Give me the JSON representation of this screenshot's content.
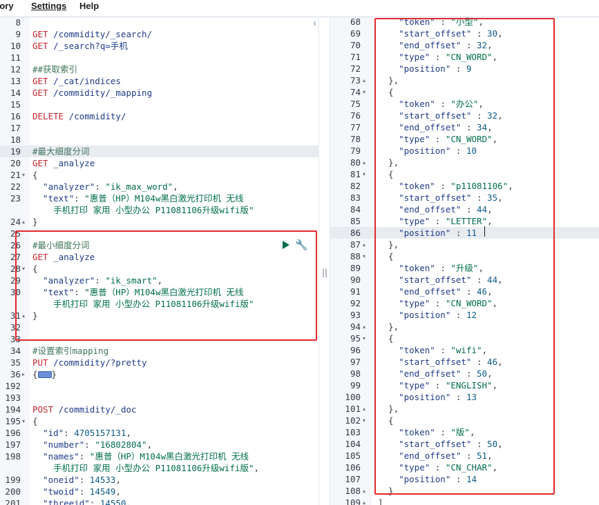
{
  "menu": {
    "items": [
      "tory",
      "Settings",
      "Help"
    ],
    "active_index": 1
  },
  "left_editor": {
    "lines": [
      {
        "n": "8",
        "parts": []
      },
      {
        "n": "9",
        "parts": [
          [
            "method",
            "GET"
          ],
          [
            "url",
            " /commidity/_search/"
          ]
        ]
      },
      {
        "n": "10",
        "parts": [
          [
            "method",
            "GET"
          ],
          [
            "url",
            " /_search?q=手机"
          ]
        ]
      },
      {
        "n": "11",
        "parts": []
      },
      {
        "n": "12",
        "parts": [
          [
            "comment",
            "##获取索引"
          ]
        ]
      },
      {
        "n": "13",
        "parts": [
          [
            "method",
            "GET"
          ],
          [
            "url",
            " /_cat/indices"
          ]
        ]
      },
      {
        "n": "14",
        "parts": [
          [
            "method",
            "GET"
          ],
          [
            "url",
            " /commidity/_mapping"
          ]
        ]
      },
      {
        "n": "15",
        "parts": []
      },
      {
        "n": "16",
        "parts": [
          [
            "method",
            "DELETE"
          ],
          [
            "url",
            " /commidity/"
          ]
        ]
      },
      {
        "n": "17",
        "parts": []
      },
      {
        "n": "18",
        "parts": []
      },
      {
        "n": "19",
        "hl": true,
        "parts": [
          [
            "comment",
            "#最大细度分词"
          ]
        ]
      },
      {
        "n": "20",
        "parts": [
          [
            "method",
            "GET"
          ],
          [
            "url",
            " _analyze"
          ]
        ]
      },
      {
        "n": "21",
        "fold": "▾",
        "parts": [
          [
            "punc",
            "{"
          ]
        ]
      },
      {
        "n": "22",
        "parts": [
          [
            "key",
            "  \"analyzer\""
          ],
          [
            "punc",
            ": "
          ],
          [
            "str",
            "\"ik_max_word\""
          ],
          [
            "punc",
            ","
          ]
        ]
      },
      {
        "n": "23",
        "parts": [
          [
            "key",
            "  \"text\""
          ],
          [
            "punc",
            ": "
          ],
          [
            "str",
            "\"惠普（HP）M104w黑白激光打印机 无线"
          ]
        ]
      },
      {
        "n": "",
        "parts": [
          [
            "str",
            "    手机打印 家用 小型办公 P11081106升级wifi版\""
          ]
        ]
      },
      {
        "n": "24",
        "fold": "▴",
        "parts": [
          [
            "punc",
            "}"
          ]
        ]
      },
      {
        "n": "25",
        "parts": []
      },
      {
        "n": "26",
        "parts": [
          [
            "comment",
            "#最小细度分词"
          ]
        ]
      },
      {
        "n": "27",
        "parts": [
          [
            "method",
            "GET"
          ],
          [
            "url",
            " _analyze"
          ]
        ]
      },
      {
        "n": "28",
        "fold": "▾",
        "parts": [
          [
            "punc",
            "{"
          ]
        ]
      },
      {
        "n": "29",
        "parts": [
          [
            "key",
            "  \"analyzer\""
          ],
          [
            "punc",
            ": "
          ],
          [
            "str",
            "\"ik_smart\""
          ],
          [
            "punc",
            ","
          ]
        ]
      },
      {
        "n": "30",
        "parts": [
          [
            "key",
            "  \"text\""
          ],
          [
            "punc",
            ": "
          ],
          [
            "str",
            "\"惠普（HP）M104w黑白激光打印机 无线"
          ]
        ]
      },
      {
        "n": "",
        "parts": [
          [
            "str",
            "    手机打印 家用 小型办公 P11081106升级wifi版\""
          ]
        ]
      },
      {
        "n": "31",
        "fold": "▴",
        "parts": [
          [
            "punc",
            "}"
          ]
        ]
      },
      {
        "n": "32",
        "parts": []
      },
      {
        "n": "33",
        "parts": []
      },
      {
        "n": "34",
        "parts": [
          [
            "comment",
            "#设置索引mapping"
          ]
        ]
      },
      {
        "n": "35",
        "parts": [
          [
            "method",
            "PUT"
          ],
          [
            "url",
            " /commidity/?pretty"
          ]
        ]
      },
      {
        "n": "36",
        "fold": "▸",
        "parts": [
          [
            "punc",
            "{"
          ],
          [
            "foldbox",
            ""
          ],
          [
            "punc",
            "}"
          ]
        ]
      },
      {
        "n": "192",
        "parts": []
      },
      {
        "n": "193",
        "parts": []
      },
      {
        "n": "194",
        "parts": [
          [
            "method",
            "POST"
          ],
          [
            "url",
            " /commidity/_doc"
          ]
        ]
      },
      {
        "n": "195",
        "fold": "▾",
        "parts": [
          [
            "punc",
            "{"
          ]
        ]
      },
      {
        "n": "196",
        "parts": [
          [
            "key",
            "  \"id\""
          ],
          [
            "punc",
            ": "
          ],
          [
            "num",
            "4705157131"
          ],
          [
            "punc",
            ","
          ]
        ]
      },
      {
        "n": "197",
        "parts": [
          [
            "key",
            "  \"number\""
          ],
          [
            "punc",
            ": "
          ],
          [
            "str",
            "\"16802804\""
          ],
          [
            "punc",
            ","
          ]
        ]
      },
      {
        "n": "198",
        "parts": [
          [
            "key",
            "  \"names\""
          ],
          [
            "punc",
            ": "
          ],
          [
            "str",
            "\"惠普（HP）M104w黑白激光打印机 无线"
          ]
        ]
      },
      {
        "n": "",
        "parts": [
          [
            "str",
            "    手机打印 家用 小型办公 P11081106升级wifi版\""
          ],
          [
            "punc",
            ","
          ]
        ]
      },
      {
        "n": "199",
        "parts": [
          [
            "key",
            "  \"oneid\""
          ],
          [
            "punc",
            ": "
          ],
          [
            "num",
            "14533"
          ],
          [
            "punc",
            ","
          ]
        ]
      },
      {
        "n": "200",
        "parts": [
          [
            "key",
            "  \"twoid\""
          ],
          [
            "punc",
            ": "
          ],
          [
            "num",
            "14549"
          ],
          [
            "punc",
            ","
          ]
        ]
      },
      {
        "n": "201",
        "parts": [
          [
            "key",
            "  \"threeid\""
          ],
          [
            "punc",
            ": "
          ],
          [
            "num",
            "14550"
          ],
          [
            "punc",
            ","
          ]
        ]
      }
    ]
  },
  "right_editor": {
    "lines": [
      {
        "n": "68",
        "parts": [
          [
            "key",
            "    \"token\""
          ],
          [
            "punc",
            " : "
          ],
          [
            "str",
            "\"小型\""
          ],
          [
            "punc",
            ","
          ]
        ]
      },
      {
        "n": "69",
        "parts": [
          [
            "key",
            "    \"start_offset\""
          ],
          [
            "punc",
            " : "
          ],
          [
            "num",
            "30"
          ],
          [
            "punc",
            ","
          ]
        ]
      },
      {
        "n": "70",
        "parts": [
          [
            "key",
            "    \"end_offset\""
          ],
          [
            "punc",
            " : "
          ],
          [
            "num",
            "32"
          ],
          [
            "punc",
            ","
          ]
        ]
      },
      {
        "n": "71",
        "parts": [
          [
            "key",
            "    \"type\""
          ],
          [
            "punc",
            " : "
          ],
          [
            "str",
            "\"CN_WORD\""
          ],
          [
            "punc",
            ","
          ]
        ]
      },
      {
        "n": "72",
        "parts": [
          [
            "key",
            "    \"position\""
          ],
          [
            "punc",
            " : "
          ],
          [
            "num",
            "9"
          ]
        ]
      },
      {
        "n": "73",
        "fold": "▴",
        "parts": [
          [
            "punc",
            "  },"
          ]
        ]
      },
      {
        "n": "74",
        "fold": "▾",
        "parts": [
          [
            "punc",
            "  {"
          ]
        ]
      },
      {
        "n": "75",
        "parts": [
          [
            "key",
            "    \"token\""
          ],
          [
            "punc",
            " : "
          ],
          [
            "str",
            "\"办公\""
          ],
          [
            "punc",
            ","
          ]
        ]
      },
      {
        "n": "76",
        "parts": [
          [
            "key",
            "    \"start_offset\""
          ],
          [
            "punc",
            " : "
          ],
          [
            "num",
            "32"
          ],
          [
            "punc",
            ","
          ]
        ]
      },
      {
        "n": "77",
        "parts": [
          [
            "key",
            "    \"end_offset\""
          ],
          [
            "punc",
            " : "
          ],
          [
            "num",
            "34"
          ],
          [
            "punc",
            ","
          ]
        ]
      },
      {
        "n": "78",
        "parts": [
          [
            "key",
            "    \"type\""
          ],
          [
            "punc",
            " : "
          ],
          [
            "str",
            "\"CN_WORD\""
          ],
          [
            "punc",
            ","
          ]
        ]
      },
      {
        "n": "79",
        "parts": [
          [
            "key",
            "    \"position\""
          ],
          [
            "punc",
            " : "
          ],
          [
            "num",
            "10"
          ]
        ]
      },
      {
        "n": "80",
        "fold": "▴",
        "parts": [
          [
            "punc",
            "  },"
          ]
        ]
      },
      {
        "n": "81",
        "fold": "▾",
        "parts": [
          [
            "punc",
            "  {"
          ]
        ]
      },
      {
        "n": "82",
        "parts": [
          [
            "key",
            "    \"token\""
          ],
          [
            "punc",
            " : "
          ],
          [
            "str",
            "\"p11081106\""
          ],
          [
            "punc",
            ","
          ]
        ]
      },
      {
        "n": "83",
        "parts": [
          [
            "key",
            "    \"start_offset\""
          ],
          [
            "punc",
            " : "
          ],
          [
            "num",
            "35"
          ],
          [
            "punc",
            ","
          ]
        ]
      },
      {
        "n": "84",
        "parts": [
          [
            "key",
            "    \"end_offset\""
          ],
          [
            "punc",
            " : "
          ],
          [
            "num",
            "44"
          ],
          [
            "punc",
            ","
          ]
        ]
      },
      {
        "n": "85",
        "parts": [
          [
            "key",
            "    \"type\""
          ],
          [
            "punc",
            " : "
          ],
          [
            "str",
            "\"LETTER\""
          ],
          [
            "punc",
            ","
          ]
        ]
      },
      {
        "n": "86",
        "hl": true,
        "parts": [
          [
            "key",
            "    \"position\""
          ],
          [
            "punc",
            " : "
          ],
          [
            "num",
            "11"
          ]
        ]
      },
      {
        "n": "87",
        "fold": "▴",
        "parts": [
          [
            "punc",
            "  },"
          ]
        ]
      },
      {
        "n": "88",
        "fold": "▾",
        "parts": [
          [
            "punc",
            "  {"
          ]
        ]
      },
      {
        "n": "89",
        "parts": [
          [
            "key",
            "    \"token\""
          ],
          [
            "punc",
            " : "
          ],
          [
            "str",
            "\"升级\""
          ],
          [
            "punc",
            ","
          ]
        ]
      },
      {
        "n": "90",
        "parts": [
          [
            "key",
            "    \"start_offset\""
          ],
          [
            "punc",
            " : "
          ],
          [
            "num",
            "44"
          ],
          [
            "punc",
            ","
          ]
        ]
      },
      {
        "n": "91",
        "parts": [
          [
            "key",
            "    \"end_offset\""
          ],
          [
            "punc",
            " : "
          ],
          [
            "num",
            "46"
          ],
          [
            "punc",
            ","
          ]
        ]
      },
      {
        "n": "92",
        "parts": [
          [
            "key",
            "    \"type\""
          ],
          [
            "punc",
            " : "
          ],
          [
            "str",
            "\"CN_WORD\""
          ],
          [
            "punc",
            ","
          ]
        ]
      },
      {
        "n": "93",
        "parts": [
          [
            "key",
            "    \"position\""
          ],
          [
            "punc",
            " : "
          ],
          [
            "num",
            "12"
          ]
        ]
      },
      {
        "n": "94",
        "fold": "▴",
        "parts": [
          [
            "punc",
            "  },"
          ]
        ]
      },
      {
        "n": "95",
        "fold": "▾",
        "parts": [
          [
            "punc",
            "  {"
          ]
        ]
      },
      {
        "n": "96",
        "parts": [
          [
            "key",
            "    \"token\""
          ],
          [
            "punc",
            " : "
          ],
          [
            "str",
            "\"wifi\""
          ],
          [
            "punc",
            ","
          ]
        ]
      },
      {
        "n": "97",
        "parts": [
          [
            "key",
            "    \"start_offset\""
          ],
          [
            "punc",
            " : "
          ],
          [
            "num",
            "46"
          ],
          [
            "punc",
            ","
          ]
        ]
      },
      {
        "n": "98",
        "parts": [
          [
            "key",
            "    \"end_offset\""
          ],
          [
            "punc",
            " : "
          ],
          [
            "num",
            "50"
          ],
          [
            "punc",
            ","
          ]
        ]
      },
      {
        "n": "99",
        "parts": [
          [
            "key",
            "    \"type\""
          ],
          [
            "punc",
            " : "
          ],
          [
            "str",
            "\"ENGLISH\""
          ],
          [
            "punc",
            ","
          ]
        ]
      },
      {
        "n": "100",
        "parts": [
          [
            "key",
            "    \"position\""
          ],
          [
            "punc",
            " : "
          ],
          [
            "num",
            "13"
          ]
        ]
      },
      {
        "n": "101",
        "fold": "▴",
        "parts": [
          [
            "punc",
            "  },"
          ]
        ]
      },
      {
        "n": "102",
        "fold": "▾",
        "parts": [
          [
            "punc",
            "  {"
          ]
        ]
      },
      {
        "n": "103",
        "parts": [
          [
            "key",
            "    \"token\""
          ],
          [
            "punc",
            " : "
          ],
          [
            "str",
            "\"版\""
          ],
          [
            "punc",
            ","
          ]
        ]
      },
      {
        "n": "104",
        "parts": [
          [
            "key",
            "    \"start_offset\""
          ],
          [
            "punc",
            " : "
          ],
          [
            "num",
            "50"
          ],
          [
            "punc",
            ","
          ]
        ]
      },
      {
        "n": "105",
        "parts": [
          [
            "key",
            "    \"end_offset\""
          ],
          [
            "punc",
            " : "
          ],
          [
            "num",
            "51"
          ],
          [
            "punc",
            ","
          ]
        ]
      },
      {
        "n": "106",
        "parts": [
          [
            "key",
            "    \"type\""
          ],
          [
            "punc",
            " : "
          ],
          [
            "str",
            "\"CN_CHAR\""
          ],
          [
            "punc",
            ","
          ]
        ]
      },
      {
        "n": "107",
        "parts": [
          [
            "key",
            "    \"position\""
          ],
          [
            "punc",
            " : "
          ],
          [
            "num",
            "14"
          ]
        ]
      },
      {
        "n": "108",
        "fold": "▴",
        "parts": [
          [
            "punc",
            "  }"
          ]
        ]
      },
      {
        "n": "109",
        "fold": "▴",
        "parts": [
          [
            "punc",
            "]"
          ]
        ]
      }
    ]
  },
  "splitter_glyph": "||",
  "colors": {
    "annotation_box": "#e0282e",
    "play": "#006e4a",
    "wrench": "#0061a6"
  }
}
